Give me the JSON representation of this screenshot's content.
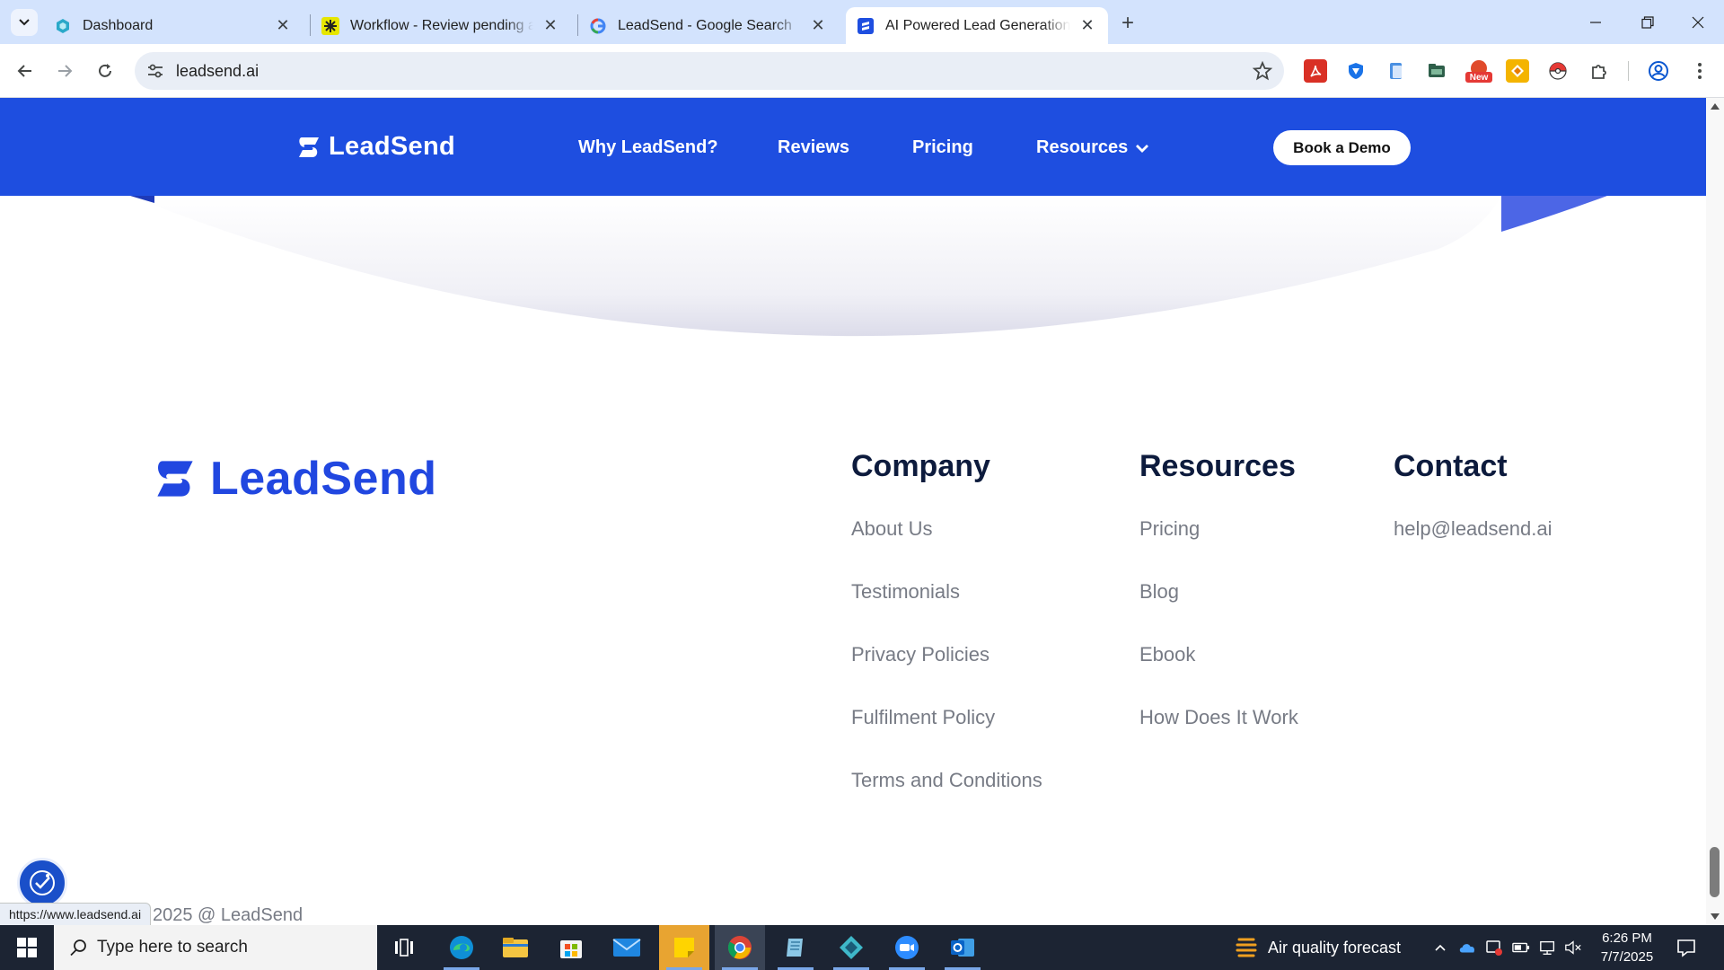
{
  "browser": {
    "tabs": [
      {
        "title": "Dashboard",
        "active": false
      },
      {
        "title": "Workflow - Review pending approvals",
        "active": false
      },
      {
        "title": "LeadSend - Google Search",
        "active": false
      },
      {
        "title": "AI Powered Lead Generation Software",
        "active": true
      }
    ],
    "url": "leadsend.ai",
    "status_url": "https://www.leadsend.ai",
    "ext_badge": "New"
  },
  "header": {
    "brand": "LeadSend",
    "nav": [
      "Why LeadSend?",
      "Reviews",
      "Pricing",
      "Resources"
    ],
    "cta": "Book a Demo"
  },
  "footer": {
    "brand": "LeadSend",
    "columns": [
      {
        "heading": "Company",
        "links": [
          "About Us",
          "Testimonials",
          "Privacy Policies",
          "Fulfilment Policy",
          "Terms and Conditions"
        ]
      },
      {
        "heading": "Resources",
        "links": [
          "Pricing",
          "Blog",
          "Ebook",
          "How Does It Work"
        ]
      },
      {
        "heading": "Contact",
        "links": [
          "help@leadsend.ai"
        ]
      }
    ],
    "copyright": "2025 @ LeadSend"
  },
  "taskbar": {
    "search_placeholder": "Type here to search",
    "weather": "Air quality forecast",
    "time": "6:26 PM",
    "date": "7/7/2025"
  },
  "colors": {
    "brand_blue": "#1e4ee0",
    "logo_blue": "#2147e0",
    "heading": "#0d1b3d",
    "link_gray": "#777b85"
  }
}
